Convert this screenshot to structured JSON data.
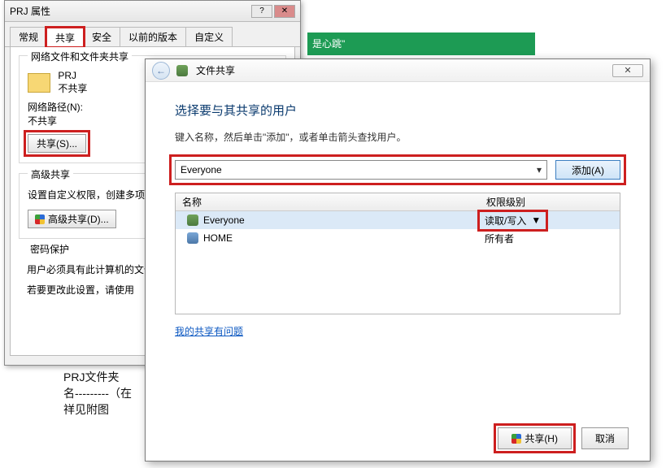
{
  "background": {
    "green_bar_text": "是心跳\"",
    "text_lines": "PRJ文件夹\n名---------（在\n祥见附图"
  },
  "prj_window": {
    "title": "PRJ 属性",
    "tabs": [
      "常规",
      "共享",
      "安全",
      "以前的版本",
      "自定义"
    ],
    "active_tab_index": 1,
    "section1_title": "网络文件和文件夹共享",
    "folder_name": "PRJ",
    "folder_status": "不共享",
    "netpath_label": "网络路径(N):",
    "netpath_value": "不共享",
    "share_button": "共享(S)...",
    "section2_title": "高级共享",
    "adv_desc": "设置自定义权限，创建多项。",
    "adv_button": "高级共享(D)...",
    "section3_title": "密码保护",
    "pwd_line1": "用户必须具有此计算机的文件夹。",
    "pwd_line2": "若要更改此设置，请使用",
    "close_button": "关闭"
  },
  "wizard": {
    "title": "文件共享",
    "heading": "选择要与其共享的用户",
    "subtext": "键入名称，然后单击\"添加\"，或者单击箭头查找用户。",
    "combo_value": "Everyone",
    "add_label": "添加(A)",
    "col_name": "名称",
    "col_perm": "权限级别",
    "rows": [
      {
        "name": "Everyone",
        "perm": "读取/写入",
        "has_dropdown": true,
        "icon": "group",
        "selected": true
      },
      {
        "name": "HOME",
        "perm": "所有者",
        "has_dropdown": false,
        "icon": "user",
        "selected": false
      }
    ],
    "help_link": "我的共享有问题",
    "share_button": "共享(H)",
    "cancel_button": "取消"
  }
}
